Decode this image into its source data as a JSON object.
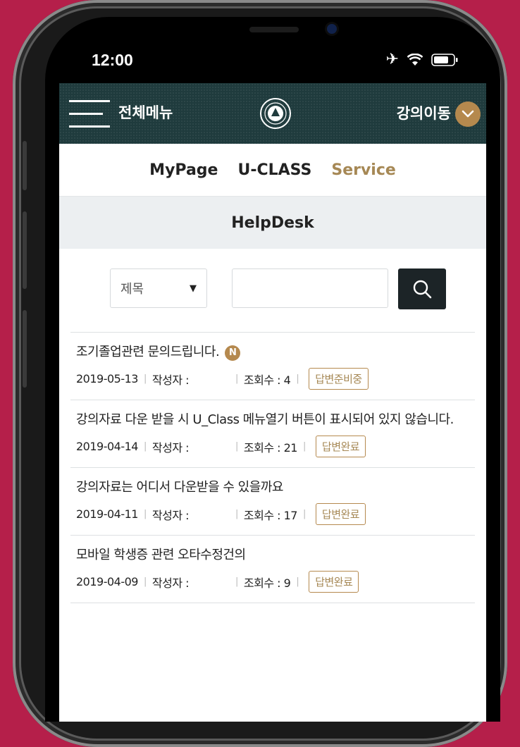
{
  "status_bar": {
    "time": "12:00"
  },
  "header": {
    "menu_label": "전체메뉴",
    "move_label": "강의이동"
  },
  "tabs": [
    {
      "label": "MyPage"
    },
    {
      "label": "U-CLASS"
    },
    {
      "label": "Service",
      "active": true
    }
  ],
  "page_title": "HelpDesk",
  "search": {
    "select_value": "제목",
    "input_value": ""
  },
  "posts": [
    {
      "title": "조기졸업관련 문의드립니다.",
      "new_badge": "N",
      "date": "2019-05-13",
      "author_label": "작성자 :",
      "views_label": "조회수 : 4",
      "status": "답변준비중"
    },
    {
      "title": "강의자료 다운 받을 시 U_Class 메뉴열기 버튼이 표시되어 있지 않습니다.",
      "date": "2019-04-14",
      "author_label": "작성자 :",
      "views_label": "조회수 : 21",
      "status": "답변완료"
    },
    {
      "title": "강의자료는 어디서 다운받을 수 있을까요",
      "date": "2019-04-11",
      "author_label": "작성자 :",
      "views_label": "조회수 : 17",
      "status": "답변완료"
    },
    {
      "title": "모바일 학생증 관련 오타수정건의",
      "date": "2019-04-09",
      "author_label": "작성자 :",
      "views_label": "조회수 : 9",
      "status": "답변완료"
    }
  ],
  "colors": {
    "background": "#b51f4a",
    "header": "#1f3b3d",
    "accent": "#b5894e"
  }
}
